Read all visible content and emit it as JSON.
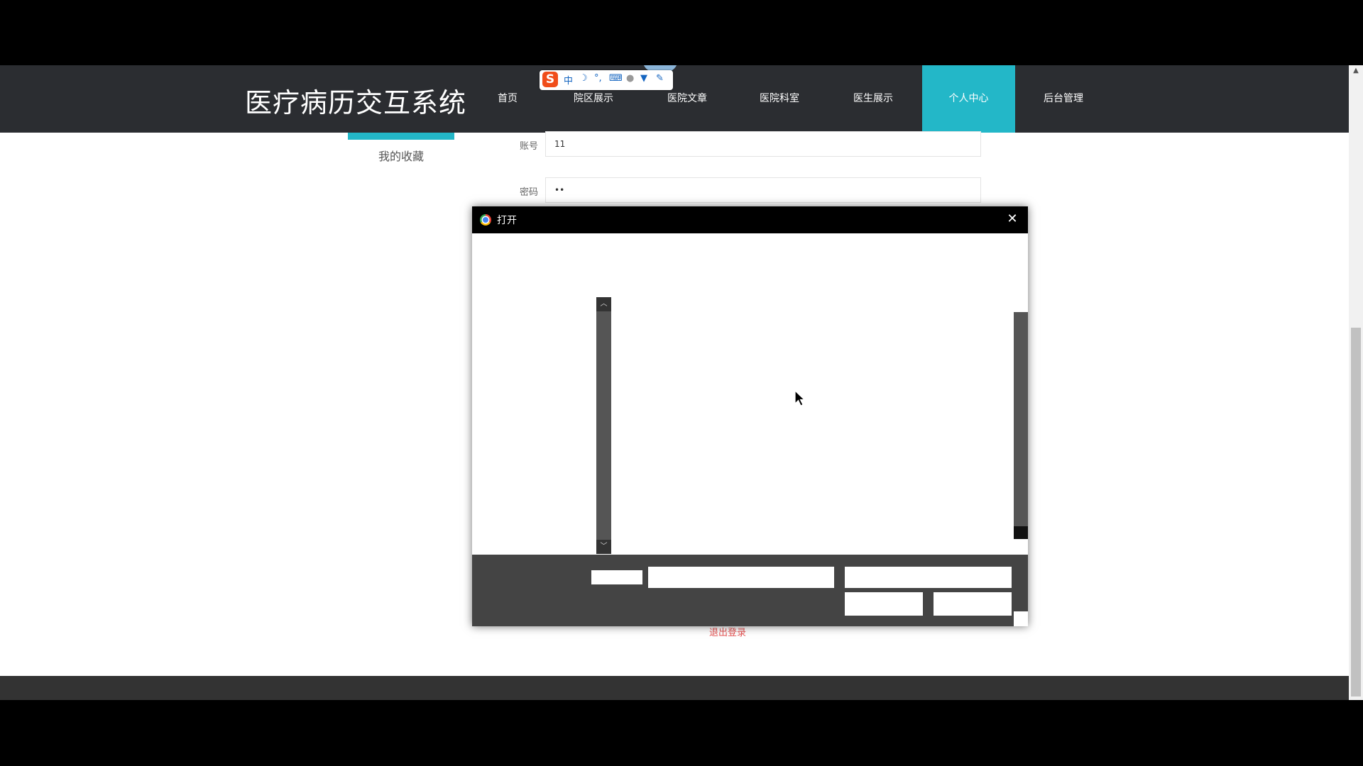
{
  "site": {
    "title": "医疗病历交互系统",
    "nav": [
      {
        "label": "首页",
        "active": false
      },
      {
        "label": "院区展示",
        "active": false
      },
      {
        "label": "医院文章",
        "active": false
      },
      {
        "label": "医院科室",
        "active": false
      },
      {
        "label": "医生展示",
        "active": false
      },
      {
        "label": "个人中心",
        "active": true
      },
      {
        "label": "后台管理",
        "active": false
      }
    ],
    "accent_color": "#23b7c8",
    "header_color": "#2b2d31"
  },
  "ime_toolbar": {
    "logo": "S",
    "mode_label": "中",
    "icons": [
      "moon-icon",
      "punctuation-icon",
      "keyboard-icon",
      "user-icon",
      "shirt-icon",
      "wrench-icon"
    ]
  },
  "sidebar": {
    "favorites_label": "我的收藏"
  },
  "profile_form": {
    "account_label": "账号",
    "account_value": "11",
    "password_label": "密码",
    "password_value": "••"
  },
  "logout_label": "退出登录",
  "dialog": {
    "title": "打开",
    "close_symbol": "✕",
    "browser_icon": "chrome-icon"
  }
}
